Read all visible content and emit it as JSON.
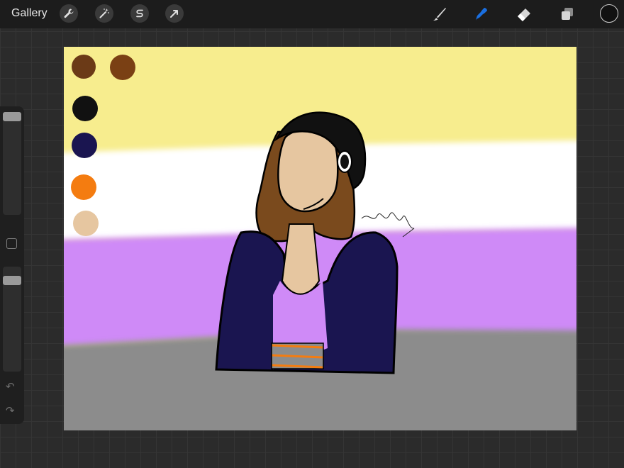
{
  "app": {
    "gallery_label": "Gallery"
  },
  "toolbar": {
    "left_icons": [
      "wrench-icon",
      "magic-wand-icon",
      "selection-s-icon",
      "transform-arrow-icon"
    ],
    "right_tools": [
      "brush-icon",
      "smudge-icon",
      "eraser-icon",
      "layers-icon"
    ],
    "active_tool": "smudge",
    "accent_color": "#1a6fe0",
    "current_color": "#111111"
  },
  "sidebar": {
    "brush_size": 1.0,
    "opacity": 0.9,
    "undo_icon": "↶",
    "redo_icon": "↷"
  },
  "canvas": {
    "flag_colors": {
      "yellow": "#f7ed8e",
      "white": "#ffffff",
      "purple": "#cf8af7",
      "gray": "#8c8c8c"
    },
    "swatches": [
      "#6b3a17",
      "#7a4014",
      "#111111",
      "#1a1550",
      "#f47c10",
      "#e6c6a0"
    ]
  }
}
